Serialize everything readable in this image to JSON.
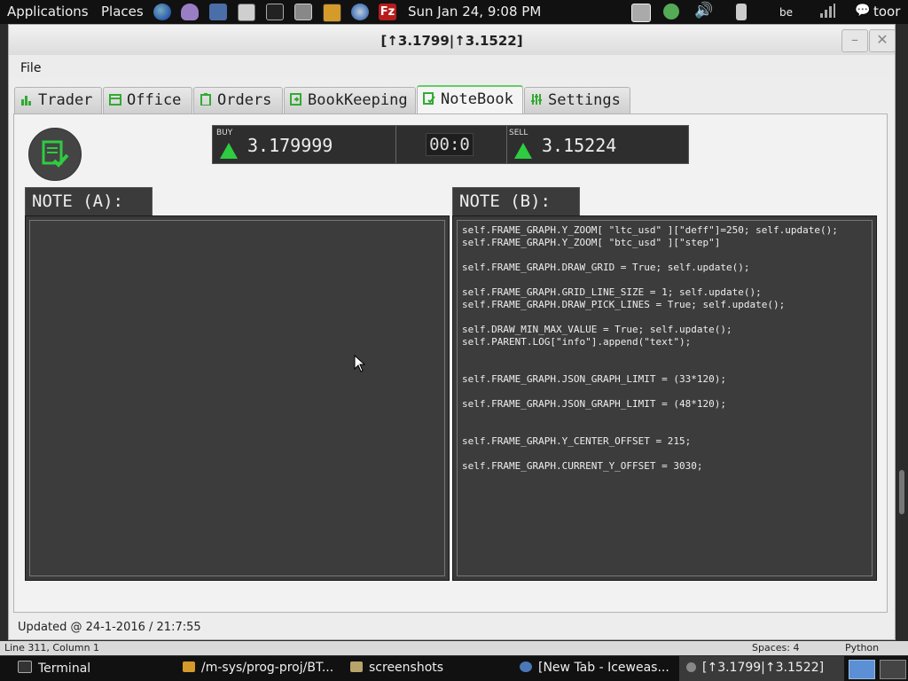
{
  "top_panel": {
    "applications": "Applications",
    "places": "Places",
    "clock": "Sun Jan 24,  9:08 PM",
    "keyboard_layout": "be",
    "user": "toor"
  },
  "window": {
    "title": "[↑3.1799|↑3.1522]",
    "minimize": "–",
    "close": "✕"
  },
  "menu": {
    "file": "File"
  },
  "tabs": [
    {
      "label": "Trader"
    },
    {
      "label": "Office"
    },
    {
      "label": "Orders"
    },
    {
      "label": "BookKeeping"
    },
    {
      "label": "NoteBook"
    },
    {
      "label": "Settings"
    }
  ],
  "ticker": {
    "buy_label": "BUY",
    "buy_value": "3.179999",
    "clock": "00:0",
    "sell_label": "SELL",
    "sell_value": "3.15224",
    "arrow_color": "#2ecc40"
  },
  "notes": {
    "a_title": "NOTE (A):",
    "a_text": "",
    "b_title": "NOTE (B):",
    "b_text": "self.FRAME_GRAPH.Y_ZOOM[ \"ltc_usd\" ][\"deff\"]=250; self.update();\nself.FRAME_GRAPH.Y_ZOOM[ \"btc_usd\" ][\"step\"]\n\nself.FRAME_GRAPH.DRAW_GRID = True; self.update();\n\nself.FRAME_GRAPH.GRID_LINE_SIZE = 1; self.update();\nself.FRAME_GRAPH.DRAW_PICK_LINES = True; self.update();\n\nself.DRAW_MIN_MAX_VALUE = True; self.update();\nself.PARENT.LOG[\"info\"].append(\"text\");\n\n\nself.FRAME_GRAPH.JSON_GRAPH_LIMIT = (33*120);\n\nself.FRAME_GRAPH.JSON_GRAPH_LIMIT = (48*120);\n\n\nself.FRAME_GRAPH.Y_CENTER_OFFSET = 215;\n\nself.FRAME_GRAPH.CURRENT_Y_OFFSET = 3030;"
  },
  "status": {
    "updated": "Updated @ 24-1-2016 / 21:7:55"
  },
  "editor_status": {
    "position": "Line 311, Column 1",
    "spaces": "Spaces: 4",
    "language": "Python"
  },
  "taskbar": [
    {
      "label": "Terminal"
    },
    {
      "label": "/m-sys/prog-proj/BT..."
    },
    {
      "label": "screenshots"
    },
    {
      "label": "[New Tab - Iceweas..."
    },
    {
      "label": "[↑3.1799|↑3.1522]"
    }
  ]
}
